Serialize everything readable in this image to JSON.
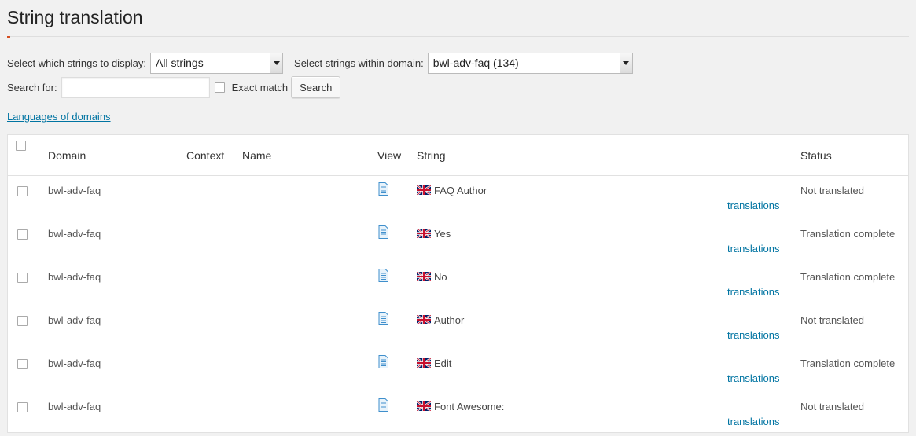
{
  "page": {
    "title": "String translation"
  },
  "filters": {
    "display_label": "Select which strings to display:",
    "display_value": "All strings",
    "domain_label": "Select strings within domain:",
    "domain_value": "bwl-adv-faq (134)",
    "search_label": "Search for:",
    "search_value": "",
    "search_placeholder": "",
    "exact_match_label": "Exact match",
    "search_button": "Search",
    "languages_link": "Languages of domains"
  },
  "table": {
    "headers": {
      "domain": "Domain",
      "context": "Context",
      "name": "Name",
      "view": "View",
      "string": "String",
      "status": "Status"
    },
    "translations_link": "translations",
    "rows": [
      {
        "domain": "bwl-adv-faq",
        "context": "",
        "name": "",
        "string": "FAQ Author",
        "status": "Not translated"
      },
      {
        "domain": "bwl-adv-faq",
        "context": "",
        "name": "",
        "string": "Yes",
        "status": "Translation complete"
      },
      {
        "domain": "bwl-adv-faq",
        "context": "",
        "name": "",
        "string": "No",
        "status": "Translation complete"
      },
      {
        "domain": "bwl-adv-faq",
        "context": "",
        "name": "",
        "string": "Author",
        "status": "Not translated"
      },
      {
        "domain": "bwl-adv-faq",
        "context": "",
        "name": "",
        "string": "Edit",
        "status": "Translation complete"
      },
      {
        "domain": "bwl-adv-faq",
        "context": "",
        "name": "",
        "string": "Font Awesome:",
        "status": "Not translated"
      }
    ]
  },
  "icons": {
    "view": "document-icon",
    "flag": "uk-flag-icon",
    "dropdown": "chevron-down-icon"
  },
  "colors": {
    "link": "#0074a2",
    "accent": "#d54e21",
    "background": "#f1f1f1"
  }
}
